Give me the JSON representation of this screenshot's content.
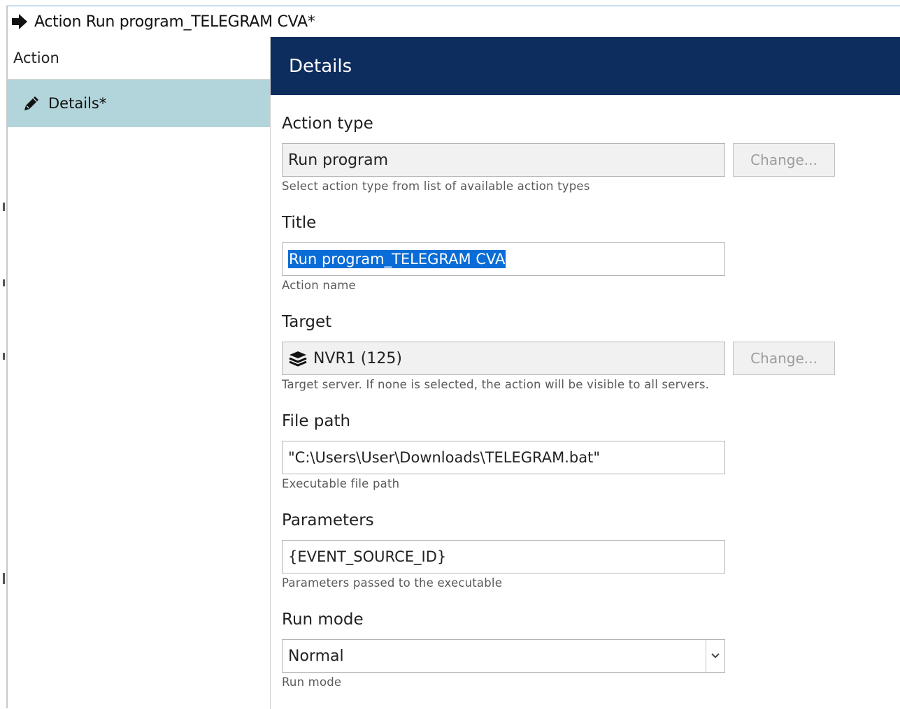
{
  "window": {
    "title": "Action Run program_TELEGRAM CVA*"
  },
  "sidebar": {
    "header": "Action",
    "items": [
      {
        "label": "Details*",
        "icon": "pencil-icon",
        "selected": true
      }
    ]
  },
  "main": {
    "banner_title": "Details",
    "fields": {
      "action_type": {
        "label": "Action type",
        "value": "Run program",
        "help": "Select action type from list of available action types",
        "button": "Change..."
      },
      "title": {
        "label": "Title",
        "value": "Run program_TELEGRAM CVA",
        "help": "Action name"
      },
      "target": {
        "label": "Target",
        "value": "NVR1 (125)",
        "icon": "server-stack-icon",
        "help": "Target server. If none is selected, the action will be visible to all servers.",
        "button": "Change..."
      },
      "file_path": {
        "label": "File path",
        "value": "\"C:\\Users\\User\\Downloads\\TELEGRAM.bat\"",
        "help": "Executable file path"
      },
      "parameters": {
        "label": "Parameters",
        "value": "{EVENT_SOURCE_ID}",
        "help": "Parameters passed to the executable"
      },
      "run_mode": {
        "label": "Run mode",
        "value": "Normal",
        "help": "Run mode"
      }
    }
  },
  "colors": {
    "banner": "#0d2d5e",
    "sidebar_selected": "#b2d5db",
    "selection": "#0a6cd6"
  }
}
